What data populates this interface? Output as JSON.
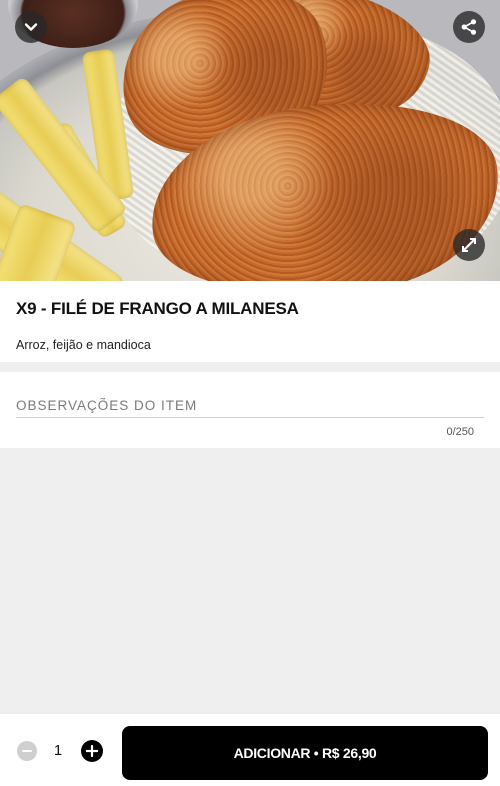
{
  "product": {
    "title": "X9 - FILÉ DE FRANGO A MILANESA",
    "description": "Arroz, feijão e mandioca",
    "image_alt": "Filé de frango a milanesa com arroz e mandioca frita"
  },
  "header": {
    "back_icon": "chevron-down-icon",
    "share_icon": "share-icon",
    "expand_icon": "expand-icon"
  },
  "notes": {
    "placeholder": "OBSERVAÇÕES DO ITEM",
    "value": "",
    "counter": "0/250"
  },
  "footer": {
    "quantity": "1",
    "add_label": "ADICIONAR • R$ 26,90",
    "minus_icon": "minus-icon",
    "plus_icon": "plus-icon"
  },
  "colors": {
    "primary": "#000000",
    "background": "#efefef",
    "disabled": "#cfcfcf"
  }
}
